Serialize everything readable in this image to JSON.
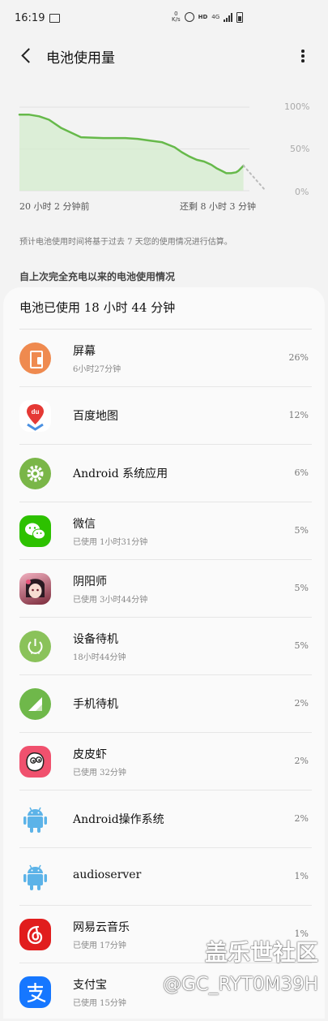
{
  "status_bar": {
    "time": "16:19",
    "net_speed_value": "0",
    "net_speed_unit": "K/s",
    "hd": "HD",
    "network": "4G"
  },
  "header": {
    "title": "电池使用量"
  },
  "chart_data": {
    "type": "line",
    "y_ticks": [
      "100%",
      "50%",
      "0%"
    ],
    "ylim": [
      0,
      100
    ],
    "x_start_label": "20 小时 2 分钟前",
    "x_end_label": "还剩 8 小时 3 分钟",
    "x": [
      0,
      0.04,
      0.08,
      0.12,
      0.17,
      0.25,
      0.34,
      0.43,
      0.48,
      0.53,
      0.58,
      0.63,
      0.66,
      0.69,
      0.72,
      0.75,
      0.78,
      0.8,
      0.82,
      0.84,
      0.86,
      0.88,
      0.89,
      0.9,
      0.91
    ],
    "series": [
      {
        "values": [
          91,
          91,
          89,
          85,
          75,
          64,
          63,
          63,
          62,
          60,
          58,
          52,
          46,
          41,
          37,
          35,
          31,
          27,
          24,
          21,
          21,
          22,
          24,
          27,
          30
        ]
      }
    ],
    "projection": {
      "from_x": 0.91,
      "from_y": 30,
      "to_x": 1.0,
      "to_y": 0
    },
    "grid": true,
    "colors": {
      "line": "#66b94a",
      "fill": "#d6ecd0",
      "projection": "#bbbbbb"
    }
  },
  "note": "预计电池使用时间将基于过去 7 天您的使用情况进行估算。",
  "section_title": "自上次完全充电以来的电池使用情况",
  "summary": "电池已使用 18 小时 44 分钟",
  "items": [
    {
      "name": "屏幕",
      "sub": "6小时27分钟",
      "pct": "26%",
      "icon": "screen-icon"
    },
    {
      "name": "百度地图",
      "sub": "",
      "pct": "12%",
      "icon": "baidu-map-icon"
    },
    {
      "name": "Android 系统应用",
      "sub": "",
      "pct": "6%",
      "icon": "android-settings-icon"
    },
    {
      "name": "微信",
      "sub": "已使用 1小时31分钟",
      "pct": "5%",
      "icon": "wechat-icon"
    },
    {
      "name": "阴阳师",
      "sub": "已使用 3小时44分钟",
      "pct": "5%",
      "icon": "onmyoji-icon"
    },
    {
      "name": "设备待机",
      "sub": "18小时44分钟",
      "pct": "5%",
      "icon": "power-standby-icon"
    },
    {
      "name": "手机待机",
      "sub": "",
      "pct": "2%",
      "icon": "signal-icon"
    },
    {
      "name": "皮皮虾",
      "sub": "已使用 32分钟",
      "pct": "2%",
      "icon": "pipixia-icon"
    },
    {
      "name": "Android操作系统",
      "sub": "",
      "pct": "2%",
      "icon": "android-robot-icon"
    },
    {
      "name": "audioserver",
      "sub": "",
      "pct": "1%",
      "icon": "android-robot-icon"
    },
    {
      "name": "网易云音乐",
      "sub": "已使用 17分钟",
      "pct": "1%",
      "icon": "netease-music-icon"
    },
    {
      "name": "支付宝",
      "sub": "已使用 15分钟",
      "pct": "",
      "icon": "alipay-icon"
    }
  ],
  "watermark": {
    "line1": "盖乐世社区",
    "line2": "@GC_RYT0M39H"
  }
}
